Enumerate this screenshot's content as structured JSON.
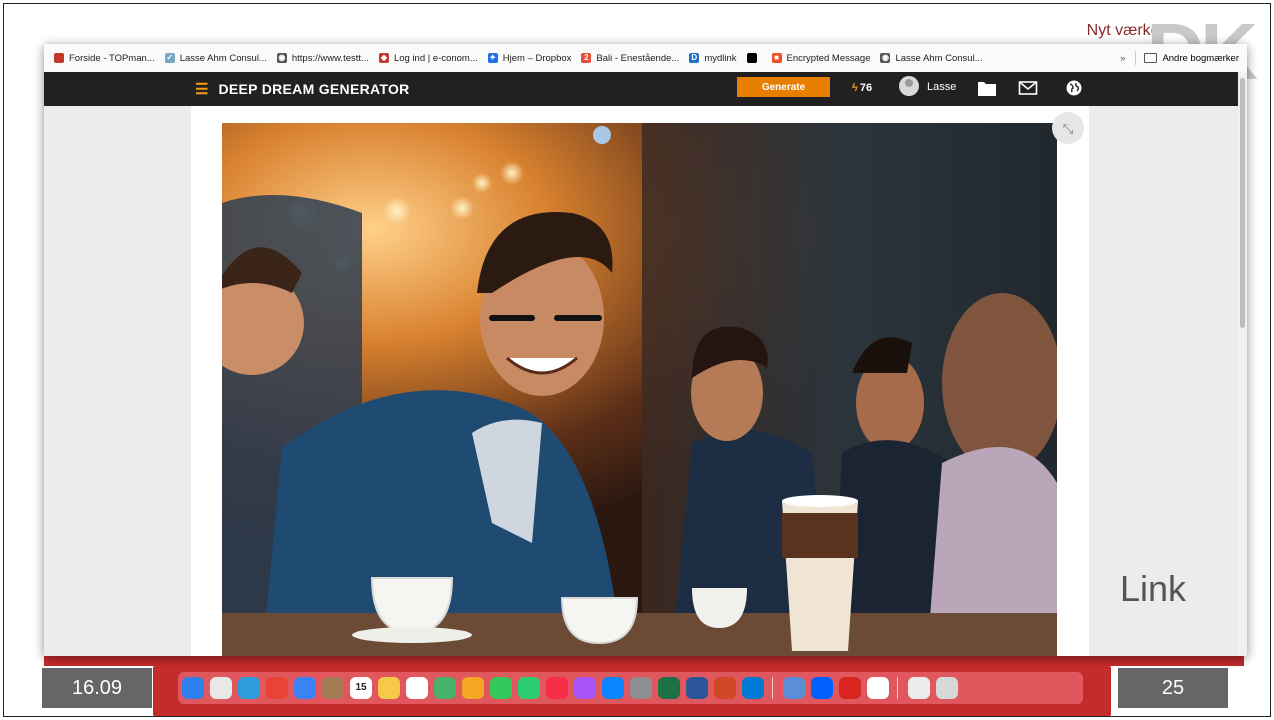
{
  "bookmarks": [
    {
      "label": "Forside - TOPman...",
      "icon": "top-logo-icon",
      "color": "#c0392b",
      "glyph": "TOP"
    },
    {
      "label": "Lasse Ahm Consul...",
      "icon": "signature-icon",
      "color": "#7aa6c2",
      "glyph": "✓"
    },
    {
      "label": "https://www.testt...",
      "icon": "globe-icon",
      "color": "#555555",
      "glyph": "◉"
    },
    {
      "label": "Log ind | e-conom...",
      "icon": "lips-icon",
      "color": "#c0392b",
      "glyph": "◆"
    },
    {
      "label": "Hjem – Dropbox",
      "icon": "dropbox-icon",
      "color": "#1f6fe5",
      "glyph": "✦"
    },
    {
      "label": "Bali - Enestående...",
      "icon": "number-two-icon",
      "color": "#e74c3c",
      "glyph": "2"
    },
    {
      "label": "mydlink",
      "icon": "mydlink-icon",
      "color": "#1a73c9",
      "glyph": "D"
    },
    {
      "label": "",
      "icon": "dr-logo-icon",
      "color": "#000000",
      "glyph": "DR"
    },
    {
      "label": "Encrypted Message",
      "icon": "microsoft-icon",
      "color": "#f25022",
      "glyph": "■"
    },
    {
      "label": "Lasse Ahm Consul...",
      "icon": "globe-icon",
      "color": "#555555",
      "glyph": "◉"
    }
  ],
  "bookmarks_more": "»",
  "other_bookmarks": "Andre bogmærker",
  "navbar": {
    "title": "DEEP DREAM GENERATOR",
    "generate_label": "Generate",
    "energy": "76",
    "user": "Lasse"
  },
  "background": {
    "top_text": "Nyt værket",
    "logo": "DK"
  },
  "slide": {
    "date": "16.09",
    "page": "25",
    "link_text": "Link"
  },
  "dock_apps": [
    {
      "name": "finder",
      "color": "#2f80ed"
    },
    {
      "name": "launchpad",
      "color": "#e8e8e8"
    },
    {
      "name": "safari",
      "color": "#2d9cdb"
    },
    {
      "name": "chrome",
      "color": "#ea4335"
    },
    {
      "name": "mail",
      "color": "#3b82f6"
    },
    {
      "name": "contacts",
      "color": "#a57c52"
    },
    {
      "name": "calendar",
      "color": "#ffffff",
      "glyph": "15"
    },
    {
      "name": "notes",
      "color": "#f7c948"
    },
    {
      "name": "reminders",
      "color": "#ffffff"
    },
    {
      "name": "maps",
      "color": "#48b26b"
    },
    {
      "name": "photos",
      "color": "#f5a623"
    },
    {
      "name": "messages",
      "color": "#34c759"
    },
    {
      "name": "facetime",
      "color": "#2ecc71"
    },
    {
      "name": "music",
      "color": "#fa2d48"
    },
    {
      "name": "podcasts",
      "color": "#a855f7"
    },
    {
      "name": "app-store",
      "color": "#0a84ff"
    },
    {
      "name": "system-settings",
      "color": "#8e8e93"
    },
    {
      "name": "excel",
      "color": "#1e7145"
    },
    {
      "name": "word",
      "color": "#2b579a"
    },
    {
      "name": "powerpoint",
      "color": "#d24726"
    },
    {
      "name": "outlook",
      "color": "#0078d4"
    },
    {
      "name": "preview",
      "color": "#5a8fd8"
    },
    {
      "name": "dropbox",
      "color": "#0061fe"
    },
    {
      "name": "acrobat",
      "color": "#d9251d"
    },
    {
      "name": "fruit-app",
      "color": "#ffffff"
    },
    {
      "name": "keyboard",
      "color": "#ececec"
    },
    {
      "name": "trash",
      "color": "#d8d8d8"
    }
  ],
  "colors": {
    "navbar_bg": "#212121",
    "accent_orange": "#e67e00",
    "slide_red": "#c42b2b"
  }
}
